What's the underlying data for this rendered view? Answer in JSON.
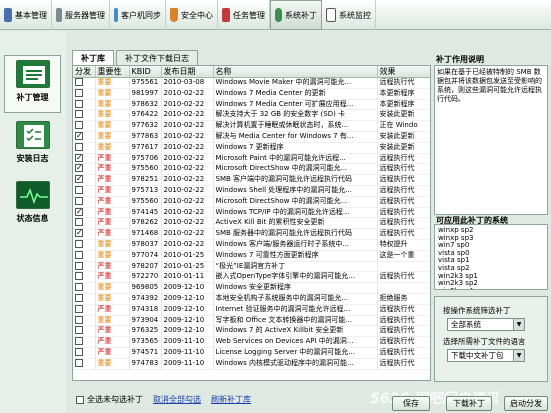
{
  "colors": {
    "important": "#e08000",
    "critical": "#d40000",
    "accent": "#1f7a3a"
  },
  "topnav": [
    {
      "label": "基本管理",
      "icon": "monitor-icon"
    },
    {
      "label": "服务器管理",
      "icon": "server-icon"
    },
    {
      "label": "客户机同步",
      "icon": "sync-icon"
    },
    {
      "label": "安全中心",
      "icon": "shield-icon"
    },
    {
      "label": "任务管理",
      "icon": "task-icon"
    },
    {
      "label": "系统补丁",
      "icon": "patch-icon"
    },
    {
      "label": "系统监控",
      "icon": "monitor-chart-icon"
    }
  ],
  "leftnav": [
    {
      "label": "补丁管理"
    },
    {
      "label": "安装日志"
    },
    {
      "label": "状态信息"
    }
  ],
  "tabs": [
    {
      "label": "补丁库"
    },
    {
      "label": "补丁文件下载日志"
    }
  ],
  "table": {
    "headers": [
      "分发",
      "重要性",
      "KBID",
      "发布日期",
      "名称",
      "效果"
    ],
    "rows": [
      {
        "checked": false,
        "level": "重要",
        "kb": "975561",
        "date": "2010-03-08",
        "name": "Windows Movie Maker 中的漏洞可能允...",
        "effect": "远程执行代"
      },
      {
        "checked": false,
        "level": "重要",
        "kb": "981997",
        "date": "2010-02-22",
        "name": "Windows 7 Media Center 的更新",
        "effect": "本更新程序"
      },
      {
        "checked": false,
        "level": "重要",
        "kb": "978632",
        "date": "2010-02-22",
        "name": "Windows 7 Media Center 可扩展应用程...",
        "effect": "本更新程序"
      },
      {
        "checked": false,
        "level": "重要",
        "kb": "976422",
        "date": "2010-02-22",
        "name": "解决支持大于 32 GB 的安全数字 (SD) 卡",
        "effect": "安装此更新"
      },
      {
        "checked": false,
        "level": "重要",
        "kb": "977632",
        "date": "2010-02-22",
        "name": "解决计算机置于睡眠或休眠状态时，系统...",
        "effect": "正在 Windo"
      },
      {
        "checked": true,
        "level": "重要",
        "kb": "977863",
        "date": "2010-02-22",
        "name": "解决与 Media Center for Windows 7 有...",
        "effect": "安装此更新"
      },
      {
        "checked": false,
        "level": "重要",
        "kb": "977617",
        "date": "2010-02-22",
        "name": "Windows 7 更新程序",
        "effect": "安装此更新"
      },
      {
        "checked": true,
        "level": "严重",
        "kb": "975706",
        "date": "2010-02-22",
        "name": "Microsoft Paint 中的漏洞可能允许远程...",
        "effect": "远程执行代"
      },
      {
        "checked": true,
        "level": "严重",
        "kb": "975560",
        "date": "2010-02-22",
        "name": "Microsoft DirectShow 中的漏洞可能允...",
        "effect": "远程执行代"
      },
      {
        "checked": true,
        "level": "严重",
        "kb": "978251",
        "date": "2010-02-22",
        "name": "SMB 客户端中的漏洞可能允许远程执行代码",
        "effect": "远程执行代"
      },
      {
        "checked": false,
        "level": "严重",
        "kb": "975713",
        "date": "2010-02-22",
        "name": "Windows Shell 处理程序中的漏洞可能允...",
        "effect": "远程执行代"
      },
      {
        "checked": false,
        "level": "严重",
        "kb": "975560",
        "date": "2010-02-22",
        "name": "Microsoft DirectShow 中的漏洞可能允...",
        "effect": "远程执行代"
      },
      {
        "checked": true,
        "level": "严重",
        "kb": "974145",
        "date": "2010-02-22",
        "name": "Windows TCP/IP 中的漏洞可能允许远程...",
        "effect": "远程执行代"
      },
      {
        "checked": false,
        "level": "严重",
        "kb": "978262",
        "date": "2010-02-22",
        "name": "ActiveX Kill Bit 的累积性安全更新",
        "effect": "远程执行代"
      },
      {
        "checked": true,
        "level": "严重",
        "kb": "971468",
        "date": "2010-02-22",
        "name": "SMB 服务器中的漏洞可能允许远程执行代码",
        "effect": "远程执行代"
      },
      {
        "checked": false,
        "level": "重要",
        "kb": "978037",
        "date": "2010-02-22",
        "name": "Windows 客户端/服务器运行时子系统中...",
        "effect": "特权提升"
      },
      {
        "checked": false,
        "level": "重要",
        "kb": "977074",
        "date": "2010-01-25",
        "name": "Windows 7 可靠性方面更新程序",
        "effect": "这是一个重"
      },
      {
        "checked": false,
        "level": "严重",
        "kb": "978207",
        "date": "2010-01-25",
        "name": "“极光”IE漏洞官方补丁",
        "effect": ""
      },
      {
        "checked": false,
        "level": "严重",
        "kb": "972270",
        "date": "2010-01-11",
        "name": "嵌入式OpenType字体引擎中的漏洞可能允...",
        "effect": "远程执行代"
      },
      {
        "checked": false,
        "level": "重要",
        "kb": "969805",
        "date": "2009-12-10",
        "name": "Windows 安全更新程序",
        "effect": ""
      },
      {
        "checked": false,
        "level": "重要",
        "kb": "974392",
        "date": "2009-12-10",
        "name": "本地安全机构子系统服务中的漏洞可能允...",
        "effect": "拒绝服务"
      },
      {
        "checked": false,
        "level": "严重",
        "kb": "974318",
        "date": "2009-12-10",
        "name": "Internet 验证服务中的漏洞可能允许远程...",
        "effect": "远程执行代"
      },
      {
        "checked": false,
        "level": "重要",
        "kb": "973904",
        "date": "2009-12-10",
        "name": "写字板和 Office 文本转换器中的漏洞可能...",
        "effect": "远程执行代"
      },
      {
        "checked": false,
        "level": "严重",
        "kb": "976325",
        "date": "2009-12-10",
        "name": "Windows 7 的 ActiveX Killbit 安全更新",
        "effect": "远程执行代"
      },
      {
        "checked": false,
        "level": "严重",
        "kb": "973565",
        "date": "2009-11-10",
        "name": "Web Services on Devices API 中的漏洞...",
        "effect": "远程执行代"
      },
      {
        "checked": false,
        "level": "严重",
        "kb": "974571",
        "date": "2009-11-10",
        "name": "License Logging Server 中的漏洞可能允...",
        "effect": "远程执行代"
      },
      {
        "checked": false,
        "level": "重要",
        "kb": "974783",
        "date": "2009-11-10",
        "name": "Windows 内核模式驱动程序中的漏洞可能...",
        "effect": "远程执行代"
      }
    ]
  },
  "right": {
    "desc_title": "补丁作用说明",
    "desc_text": "如果在基于已经被特制的 SMB 数据包并将该数据包发送至受影响的系统，则这些漏洞可能允许远程执行代码。",
    "systems_title": "可应用此补丁的系统",
    "systems": [
      "winxp sp2",
      "winxp sp3",
      "win7 sp0",
      "vista sp0",
      "vista sp1",
      "vista sp2",
      "win2k3 sp1",
      "win2k3 sp2",
      "win2k sp4",
      "win2k3 sp2"
    ],
    "filter_os_label": "按操作系统筛选补丁",
    "filter_os_value": "全部系统",
    "filter_lang_label": "选择所需补丁文件的语言",
    "filter_lang_value": "下载中文补丁包"
  },
  "bottom": {
    "select_all": "全选未勾选补丁",
    "cancel_all": "取消全部勾选",
    "refresh": "刷新补丁库",
    "save": "保存",
    "download": "下载补丁",
    "distribute": "启动分发"
  },
  "watermark": "5636 网吧门户资讯"
}
